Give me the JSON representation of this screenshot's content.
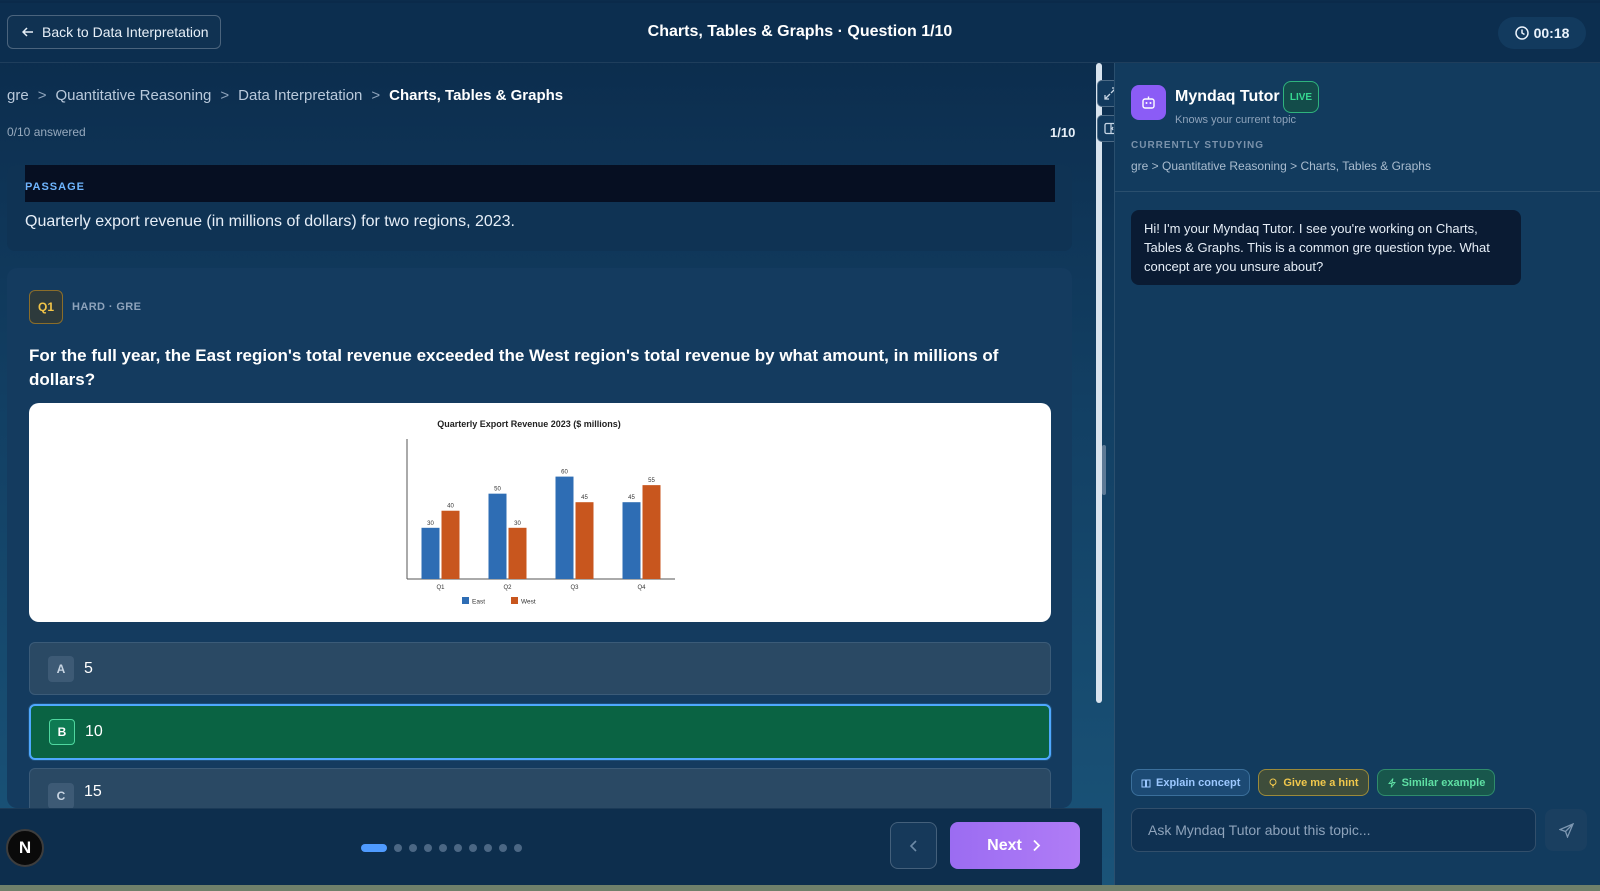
{
  "header": {
    "back_label": "Back to Data Interpretation",
    "title": "Charts, Tables & Graphs · Question 1/10",
    "timer": "00:18"
  },
  "breadcrumb": {
    "items": [
      "gre",
      "Quantitative Reasoning",
      "Data Interpretation",
      "Charts, Tables & Graphs"
    ],
    "separator": ">"
  },
  "progress": {
    "answered": "0/10 answered",
    "count": "1/10"
  },
  "passage": {
    "label": "PASSAGE",
    "text": "Quarterly export revenue (in millions of dollars) for two regions, 2023."
  },
  "question": {
    "badge": "Q1",
    "meta": "HARD · GRE",
    "text": "For the full year, the East region's total revenue exceeded the West region's total revenue by what amount, in millions of dollars?"
  },
  "chart_data": {
    "type": "bar",
    "title": "Quarterly Export Revenue 2023 ($ millions)",
    "categories": [
      "Q1",
      "Q2",
      "Q3",
      "Q4"
    ],
    "series": [
      {
        "name": "East",
        "values": [
          30,
          50,
          60,
          45
        ],
        "color": "#2e6db4"
      },
      {
        "name": "West",
        "values": [
          40,
          30,
          45,
          55
        ],
        "color": "#c8561e"
      }
    ],
    "ylim": [
      0,
      75
    ],
    "legend": "bottom",
    "grid": false
  },
  "options": [
    {
      "letter": "A",
      "value": "5",
      "selected": false
    },
    {
      "letter": "B",
      "value": "10",
      "selected": true
    },
    {
      "letter": "C",
      "value": "15",
      "selected": false
    }
  ],
  "footer": {
    "logo": "N",
    "next_label": "Next",
    "total_dots": 10,
    "current_dot": 1
  },
  "tutor": {
    "name": "Myndaq Tutor",
    "live": "LIVE",
    "subtitle": "Knows your current topic",
    "studying_label": "CURRENTLY STUDYING",
    "studying_path": "gre > Quantitative Reasoning > Charts, Tables & Graphs",
    "message": "Hi! I'm your Myndaq Tutor. I see you're working on Charts, Tables & Graphs. This is a common gre question type. What concept are you unsure about?",
    "chips": [
      "Explain concept",
      "Give me a hint",
      "Similar example"
    ],
    "input_placeholder": "Ask Myndaq Tutor about this topic..."
  },
  "colors": {
    "accent": "#9b6cf2",
    "selected_option": "#0a6343",
    "live": "#36d890"
  }
}
